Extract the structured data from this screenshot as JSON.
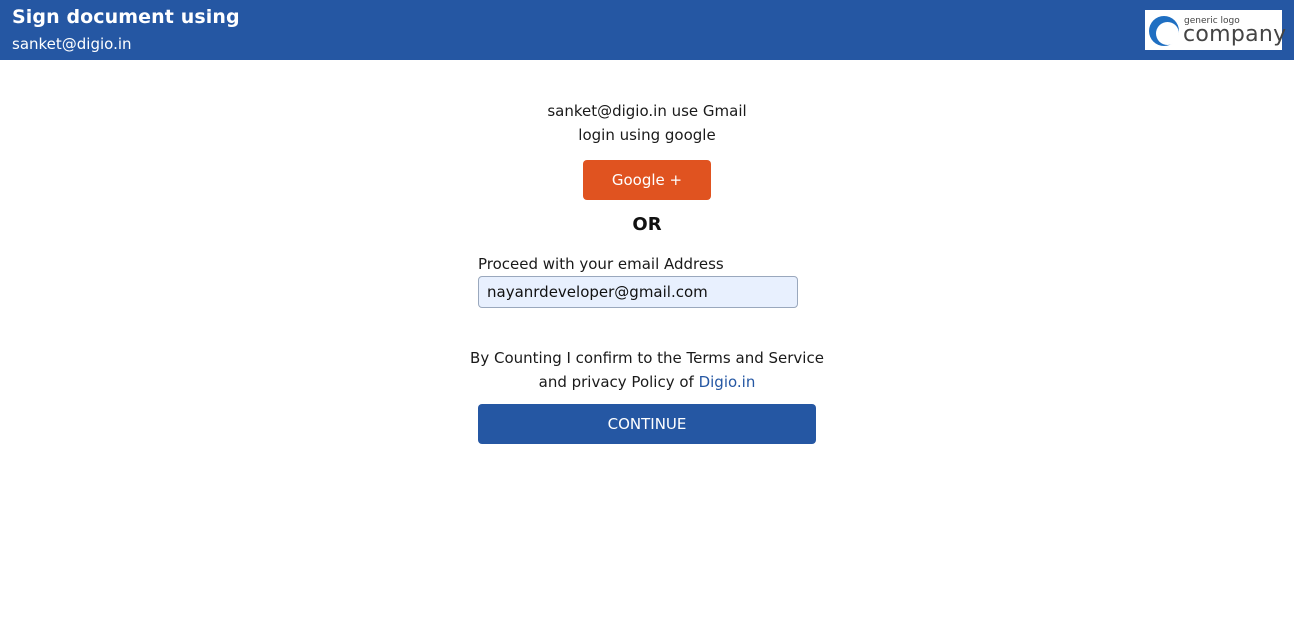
{
  "header": {
    "title": "Sign document using",
    "email": "sanket@digio.in",
    "logo": {
      "small_text": "generic logo",
      "big_text": "company",
      "icon": "company-logo-icon"
    }
  },
  "login": {
    "line1": "sanket@digio.in use Gmail",
    "line2": "login using google",
    "google_button": "Google +",
    "or_text": "OR"
  },
  "email_form": {
    "label": "Proceed with your email Address",
    "value": "nayanrdeveloper@gmail.com"
  },
  "terms": {
    "line1": "By Counting I confirm to the Terms and Service",
    "line2_prefix": "and privacy Policy of",
    "link_text": "Digio.in"
  },
  "continue_button": "CONTINUE",
  "colors": {
    "header_bg": "#2557a3",
    "google_button": "#e05320",
    "continue_button": "#2557a3",
    "input_bg": "#e8f0fe",
    "link": "#2557a3"
  }
}
